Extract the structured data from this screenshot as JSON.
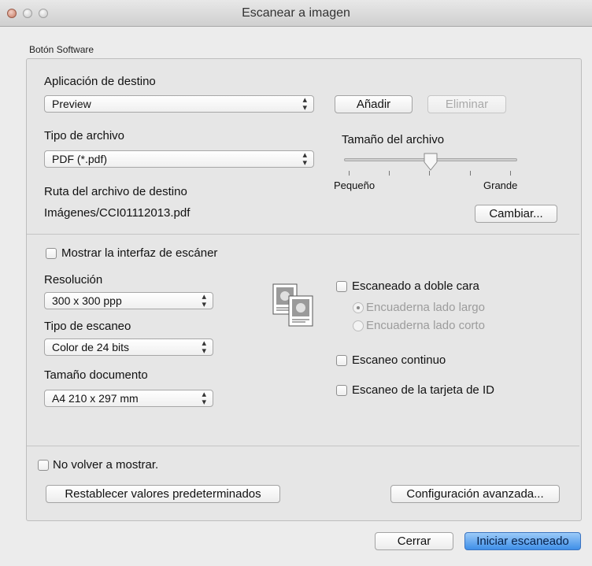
{
  "window": {
    "title": "Escanear a imagen"
  },
  "group": {
    "label": "Botón Software"
  },
  "destination": {
    "label": "Aplicación de destino",
    "app": "Preview",
    "add_label": "Añadir",
    "remove_label": "Eliminar"
  },
  "file_type": {
    "label": "Tipo de archivo",
    "value": "PDF (*.pdf)"
  },
  "file_size": {
    "label": "Tamaño del archivo",
    "min_label": "Pequeño",
    "max_label": "Grande",
    "level": 0.5
  },
  "file_path": {
    "label": "Ruta del archivo de destino",
    "value": "Imágenes/CCI01112013.pdf",
    "change_label": "Cambiar..."
  },
  "scanner_ui": {
    "label": "Mostrar la interfaz de escáner",
    "checked": false
  },
  "resolution": {
    "label": "Resolución",
    "value": "300 x 300 ppp"
  },
  "scan_type": {
    "label": "Tipo de escaneo",
    "value": "Color de 24 bits"
  },
  "doc_size": {
    "label": "Tamaño documento",
    "value": "A4 210 x 297 mm"
  },
  "duplex": {
    "label": "Escaneado a doble cara",
    "checked": false,
    "long_edge": "Encuaderna lado largo",
    "short_edge": "Encuaderna lado corto"
  },
  "continuous": {
    "label": "Escaneo continuo",
    "checked": false
  },
  "id_card": {
    "label": "Escaneo de la tarjeta de ID",
    "checked": false
  },
  "dont_show": {
    "label": "No volver a mostrar.",
    "checked": false
  },
  "buttons": {
    "restore": "Restablecer valores predeterminados",
    "advanced": "Configuración avanzada...",
    "cancel": "Cerrar",
    "start": "Iniciar escaneado"
  },
  "colors": {
    "accent": "#3f8fe8",
    "window_bg": "#ececec"
  }
}
